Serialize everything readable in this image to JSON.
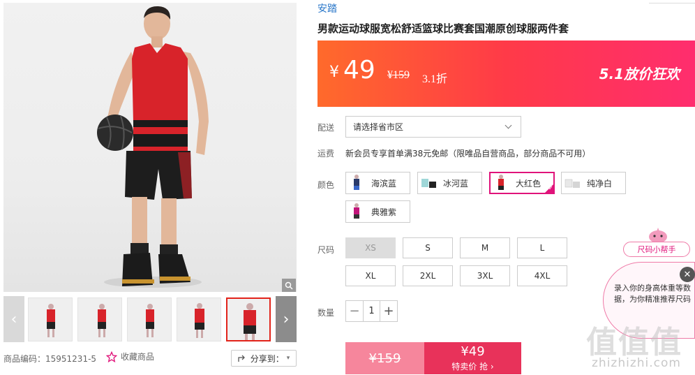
{
  "gallery": {
    "main_image_alt": "",
    "thumb_count": 6,
    "active_thumb": 5
  },
  "meta": {
    "sku": "商品编码：15951231-5",
    "favorite": "收藏商品",
    "share": "分享到："
  },
  "product": {
    "brand": "安踏",
    "title": "男款运动球服宽松舒适篮球比赛套国潮原创球服两件套"
  },
  "promo": {
    "currency": "¥",
    "price": "49",
    "original_price": "¥159",
    "discount": "3.1折",
    "tag": "5.1放价狂欢"
  },
  "delivery": {
    "label": "配送",
    "select_value": "请选择省市区"
  },
  "shipping": {
    "label": "运费",
    "text": "新会员专享首单满38元免邮（限唯品自营商品，部分商品不可用）"
  },
  "colors": {
    "label": "颜色",
    "options": [
      {
        "name": "海滨蓝",
        "shirt": "#2a3a6a",
        "shorts": "#3866c8"
      },
      {
        "name": "冰河蓝",
        "shirt": "#9fd7d8",
        "shorts": "#222"
      },
      {
        "name": "大红色",
        "shirt": "#d8232a",
        "shorts": "#222"
      },
      {
        "name": "纯净白",
        "shirt": "#f2f2f2",
        "shorts": "#ddd"
      },
      {
        "name": "典雅紫",
        "shirt": "#c2157a",
        "shorts": "#333"
      }
    ],
    "selected": "大红色"
  },
  "sizes": {
    "label": "尺码",
    "options": [
      "XS",
      "S",
      "M",
      "L",
      "XL",
      "2XL",
      "3XL",
      "4XL"
    ],
    "disabled": [
      "XS"
    ]
  },
  "quantity": {
    "label": "数量",
    "value": "1",
    "minus": "−",
    "plus": "+"
  },
  "buy": {
    "original": "¥159",
    "deal_price": "¥49",
    "deal_label": "特卖价 抢 ›"
  },
  "helper": {
    "button": "尺码小帮手",
    "text": "录入你的身高体重等数据，为你精准推荐尺码",
    "close": "✕"
  },
  "watermark": {
    "logo": "值值值",
    "site": "zhizhizhi.com"
  },
  "colors_theme": {
    "accent_red": "#e8325a",
    "brand_blue": "#2a77c9",
    "select_pink": "#e0137a"
  }
}
